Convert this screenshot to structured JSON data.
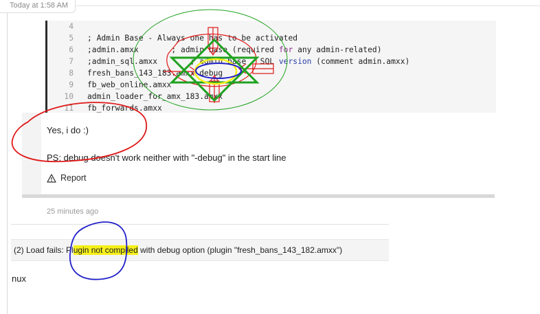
{
  "header": {
    "timestamp": "Today at 1:58 AM"
  },
  "code": {
    "lines": [
      {
        "num": "4",
        "text": ""
      },
      {
        "num": "5",
        "pre": "; Admin Base - Always one has to be activated",
        "kw": "",
        "post": ""
      },
      {
        "num": "6",
        "pre": ";admin.amxx       ; admin base (required ",
        "kw": "for",
        "post": " any admin-related)"
      },
      {
        "num": "7",
        "pre": ";admin_sql.amxx       ; admin base - SQL ",
        "kw": "version",
        "post": " (comment admin.amxx)"
      },
      {
        "num": "8",
        "pre": "fresh_bans_143_183.amxx debug",
        "kw": "",
        "post": ""
      },
      {
        "num": "9",
        "pre": "fb_web_online.amxx",
        "kw": "",
        "post": ""
      },
      {
        "num": "10",
        "pre": "admin_loader_for_amx_183.amxx",
        "kw": "",
        "post": ""
      },
      {
        "num": "11",
        "pre": "fb_forwards.amxx",
        "kw": "",
        "post": ""
      }
    ],
    "annotation_label": "debug"
  },
  "reply": {
    "line1": "Yes, i do :)",
    "line2": "PS: debug doesn't work neither with \"-debug\" in the start line",
    "report_label": "Report",
    "time_ago": "25 minutes ago"
  },
  "error": {
    "prefix": "(2) Load fails: Pl",
    "highlight": "ugin not compiled",
    "suffix": " with debug option (plugin \"fresh_bans_143_182.amxx\")"
  },
  "footer": {
    "text": "nux"
  },
  "colors": {
    "annotation_red": "#e01818",
    "annotation_green": "#1fa21f",
    "annotation_blue": "#2020c8",
    "annotation_yellow": "#f6f01a"
  }
}
